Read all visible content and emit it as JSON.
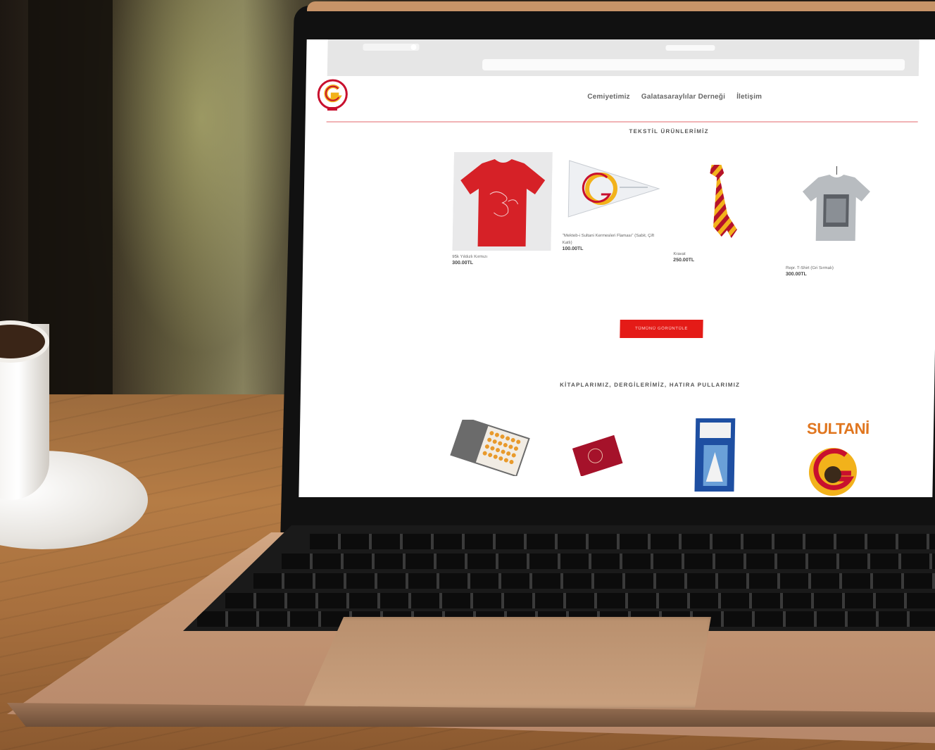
{
  "site": {
    "nav": [
      "Cemiyetimiz",
      "Galatasaraylılar Derneği",
      "İletişim"
    ],
    "logo_icon": "galatasaray-crest-icon"
  },
  "browser": {
    "url": ""
  },
  "sections": {
    "textile_title": "TEKSTİL ÜRÜNLERİMİZ",
    "books_title": "KİTAPLARIMIZ, DERGİLERİMİZ, HATIRA PULLARIMIZ"
  },
  "products": [
    {
      "name": "95k Yıldızlı Kırmızı",
      "price": "300.00TL",
      "image": "red-tshirt-image"
    },
    {
      "name": "\"Mekteb-i Sultani Kermesleri Flaması\" (Sabit, Çift Katlı)",
      "price": "100.00TL",
      "image": "pennant-flag-image"
    },
    {
      "name": "Kravat",
      "price": "250.00TL",
      "image": "striped-tie-image"
    },
    {
      "name": "Repr. T-Shirt (Gri Sırmalı)",
      "price": "300.00TL",
      "image": "grey-tshirt-image"
    }
  ],
  "cta": {
    "label": "TÜMÜNÜ GÖRÜNTÜLE"
  },
  "books": [
    {
      "image": "stamp-album-image"
    },
    {
      "image": "red-book-image"
    },
    {
      "image": "blue-book-image"
    },
    {
      "image": "sultani-magazine-image",
      "label": "SULTANİ"
    }
  ],
  "colors": {
    "accent": "#e41b17",
    "header_line": "#f1b3b5",
    "crest_yellow": "#f2b21b",
    "crest_red": "#c8102e"
  }
}
